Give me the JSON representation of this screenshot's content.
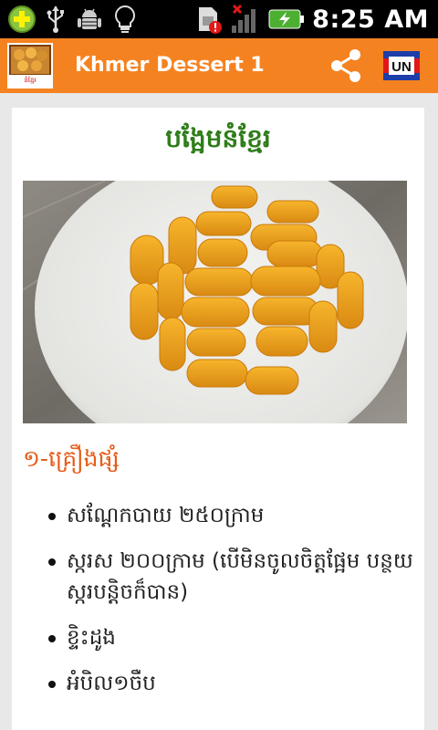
{
  "status_bar": {
    "time": "8:25 AM",
    "icons": [
      "add-icon",
      "usb-icon",
      "android-debug-icon",
      "lightbulb-icon",
      "sim-alert-icon",
      "signal-icon",
      "battery-charging-icon"
    ]
  },
  "action_bar": {
    "title": "Khmer Dessert 1",
    "logo_text": "នំខ្មែរ",
    "share_icon": "share-icon",
    "language_badge": "UN"
  },
  "recipe": {
    "title": "បង្អែមនំខ្មែរ",
    "section_heading": "១-គ្រឿងផ្សំ",
    "ingredients": [
      "សណ្តែកបាយ ២៥០ក្រាម",
      "ស្ករស ២០០ក្រាម (បើមិនចូលចិត្តផ្អែម បន្ថយស្ករបន្តិចក៏បាន)",
      "ខ្ទិះដូង",
      "អំបិល១ចឺប"
    ]
  },
  "colors": {
    "action_bar": "#f58220",
    "title_green": "#2e7d1a",
    "heading_orange": "#e65c19"
  }
}
